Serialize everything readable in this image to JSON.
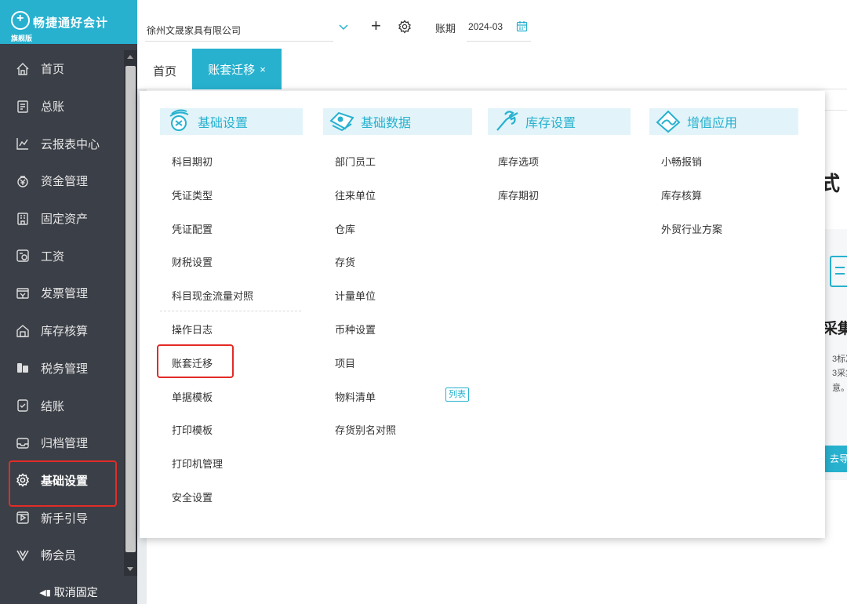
{
  "brand": {
    "name": "畅捷通好会计",
    "edition": "旗舰版"
  },
  "sidebar": {
    "items": [
      {
        "label": "首页",
        "icon": "home-icon"
      },
      {
        "label": "总账",
        "icon": "ledger-icon"
      },
      {
        "label": "云报表中心",
        "icon": "chart-icon"
      },
      {
        "label": "资金管理",
        "icon": "money-icon"
      },
      {
        "label": "固定资产",
        "icon": "building-icon"
      },
      {
        "label": "工资",
        "icon": "salary-icon"
      },
      {
        "label": "发票管理",
        "icon": "invoice-icon"
      },
      {
        "label": "库存核算",
        "icon": "warehouse-icon"
      },
      {
        "label": "税务管理",
        "icon": "tax-icon"
      },
      {
        "label": "结账",
        "icon": "checkout-icon"
      },
      {
        "label": "归档管理",
        "icon": "archive-icon"
      },
      {
        "label": "基础设置",
        "icon": "gear-icon",
        "active": true
      },
      {
        "label": "新手引导",
        "icon": "guide-icon"
      },
      {
        "label": "畅会员",
        "icon": "member-icon"
      }
    ],
    "unpin_label": "取消固定"
  },
  "header": {
    "company": "徐州文晟家具有限公司",
    "period_label": "账期",
    "period_value": "2024-03"
  },
  "tabs": {
    "home": "首页",
    "active": "账套迁移",
    "close": "×"
  },
  "background": {
    "heading_fragment": "式",
    "collect_fragment": "采集",
    "text_line1": "3标准",
    "text_line2": "3采集",
    "text_line3": "意。",
    "button_fragment": "去导"
  },
  "menu": {
    "columns": [
      {
        "title": "基础设置",
        "items": [
          "科目期初",
          "凭证类型",
          "凭证配置",
          "财税设置",
          "科目现金流量对照",
          "操作日志",
          "账套迁移",
          "单据模板",
          "打印模板",
          "打印机管理",
          "安全设置"
        ]
      },
      {
        "title": "基础数据",
        "items": [
          "部门员工",
          "往来单位",
          "仓库",
          "存货",
          "计量单位",
          "币种设置",
          "项目",
          "物料清单",
          "存货别名对照"
        ],
        "tag": "列表"
      },
      {
        "title": "库存设置",
        "items": [
          "库存选项",
          "库存期初"
        ]
      },
      {
        "title": "增值应用",
        "items": [
          "小畅报销",
          "库存核算",
          "外贸行业方案"
        ]
      }
    ]
  },
  "colors": {
    "accent": "#27b1cf",
    "sidebar": "#3b3f47",
    "highlight": "#e32b27"
  }
}
